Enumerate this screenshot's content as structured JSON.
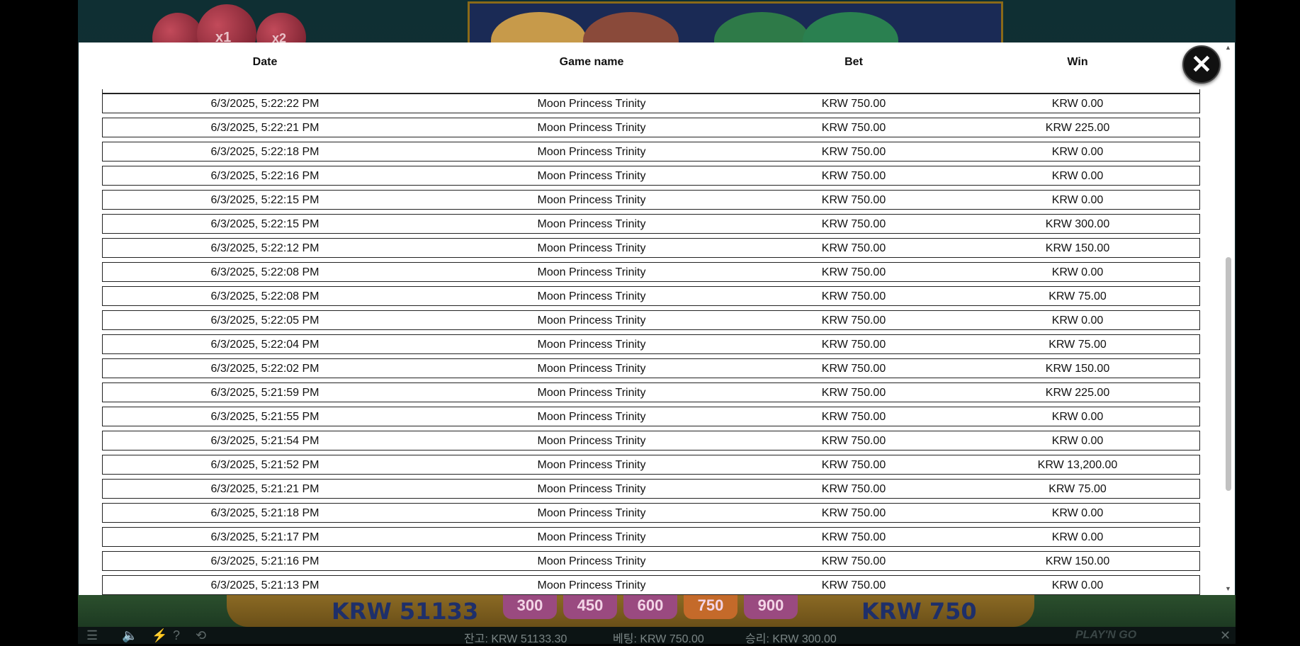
{
  "icons": {
    "close": "close-icon",
    "menu": "menu-icon",
    "sound": "sound-icon",
    "turbo": "turbo-icon",
    "help": "help-icon",
    "history": "history-icon",
    "exit": "exit-icon"
  },
  "history": {
    "columns": [
      "Date",
      "Game name",
      "Bet",
      "Win"
    ],
    "rows": [
      [
        "6/3/2025, 5:22:22 PM",
        "Moon Princess Trinity",
        "KRW 750.00",
        "KRW 0.00"
      ],
      [
        "6/3/2025, 5:22:21 PM",
        "Moon Princess Trinity",
        "KRW 750.00",
        "KRW 225.00"
      ],
      [
        "6/3/2025, 5:22:18 PM",
        "Moon Princess Trinity",
        "KRW 750.00",
        "KRW 0.00"
      ],
      [
        "6/3/2025, 5:22:16 PM",
        "Moon Princess Trinity",
        "KRW 750.00",
        "KRW 0.00"
      ],
      [
        "6/3/2025, 5:22:15 PM",
        "Moon Princess Trinity",
        "KRW 750.00",
        "KRW 0.00"
      ],
      [
        "6/3/2025, 5:22:15 PM",
        "Moon Princess Trinity",
        "KRW 750.00",
        "KRW 300.00"
      ],
      [
        "6/3/2025, 5:22:12 PM",
        "Moon Princess Trinity",
        "KRW 750.00",
        "KRW 150.00"
      ],
      [
        "6/3/2025, 5:22:08 PM",
        "Moon Princess Trinity",
        "KRW 750.00",
        "KRW 0.00"
      ],
      [
        "6/3/2025, 5:22:08 PM",
        "Moon Princess Trinity",
        "KRW 750.00",
        "KRW 75.00"
      ],
      [
        "6/3/2025, 5:22:05 PM",
        "Moon Princess Trinity",
        "KRW 750.00",
        "KRW 0.00"
      ],
      [
        "6/3/2025, 5:22:04 PM",
        "Moon Princess Trinity",
        "KRW 750.00",
        "KRW 75.00"
      ],
      [
        "6/3/2025, 5:22:02 PM",
        "Moon Princess Trinity",
        "KRW 750.00",
        "KRW 150.00"
      ],
      [
        "6/3/2025, 5:21:59 PM",
        "Moon Princess Trinity",
        "KRW 750.00",
        "KRW 225.00"
      ],
      [
        "6/3/2025, 5:21:55 PM",
        "Moon Princess Trinity",
        "KRW 750.00",
        "KRW 0.00"
      ],
      [
        "6/3/2025, 5:21:54 PM",
        "Moon Princess Trinity",
        "KRW 750.00",
        "KRW 0.00"
      ],
      [
        "6/3/2025, 5:21:52 PM",
        "Moon Princess Trinity",
        "KRW 750.00",
        "KRW 13,200.00"
      ],
      [
        "6/3/2025, 5:21:21 PM",
        "Moon Princess Trinity",
        "KRW 750.00",
        "KRW 75.00"
      ],
      [
        "6/3/2025, 5:21:18 PM",
        "Moon Princess Trinity",
        "KRW 750.00",
        "KRW 0.00"
      ],
      [
        "6/3/2025, 5:21:17 PM",
        "Moon Princess Trinity",
        "KRW 750.00",
        "KRW 0.00"
      ],
      [
        "6/3/2025, 5:21:16 PM",
        "Moon Princess Trinity",
        "KRW 750.00",
        "KRW 150.00"
      ],
      [
        "6/3/2025, 5:21:13 PM",
        "Moon Princess Trinity",
        "KRW 750.00",
        "KRW 0.00"
      ]
    ]
  },
  "game_strip": {
    "balance_display": "KRW 51133",
    "bet_display": "KRW 750",
    "bet_options": [
      "300",
      "450",
      "600",
      "750",
      "900"
    ],
    "multipliers": [
      "x1",
      "x2"
    ]
  },
  "status_bar": {
    "balance": "잔고: KRW 51133.30",
    "bet": "베팅: KRW 750.00",
    "win": "승리: KRW 300.00",
    "brand": "PLAY'N GO"
  }
}
